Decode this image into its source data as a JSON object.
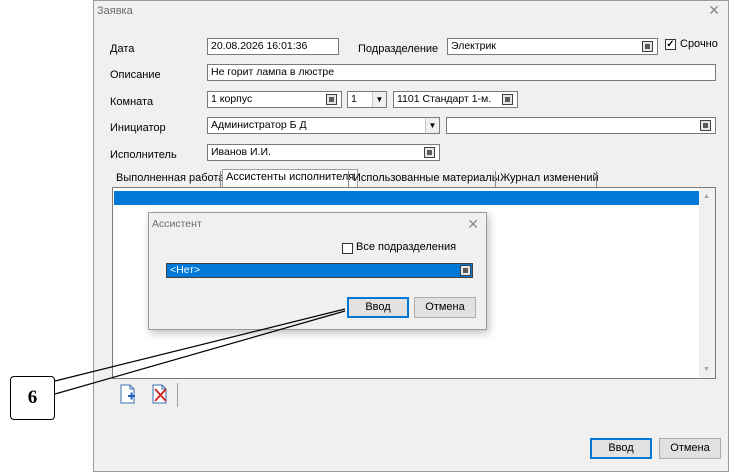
{
  "main_window": {
    "title": "Заявка",
    "close_glyph": "✕"
  },
  "form": {
    "date_label": "Дата",
    "date_value": "20.08.2026 16:01:36",
    "department_label": "Подразделение",
    "department_value": "Электрик",
    "urgent_label": "Срочно",
    "urgent_checked": true,
    "description_label": "Описание",
    "description_value": "Не горит лампа в люстре",
    "room_label": "Комната",
    "room_building": "1 корпус",
    "room_floor": "1",
    "room_number": "1101  Стандарт 1-м.",
    "initiator_label": "Инициатор",
    "initiator_value": "Администратор Б Д",
    "initiator_extra": "",
    "executor_label": "Исполнитель",
    "executor_value": "Иванов И.И."
  },
  "tabs": [
    {
      "label": "Выполненная работа",
      "active": false
    },
    {
      "label": "Ассистенты исполнителя",
      "active": true
    },
    {
      "label": "Использованные материалы",
      "active": false
    },
    {
      "label": "Журнал изменений",
      "active": false
    }
  ],
  "toolbar": {
    "add_icon": "add-document-icon",
    "delete_icon": "delete-document-icon"
  },
  "footer": {
    "ok_label": "Ввод",
    "cancel_label": "Отмена"
  },
  "assist_dialog": {
    "title": "Ассистент",
    "close_glyph": "✕",
    "all_departments_label": "Все подразделения",
    "all_departments_checked": false,
    "assistant_value": "<Нет>",
    "ok_label": "Ввод",
    "cancel_label": "Отмена"
  },
  "callout": {
    "number": "6"
  },
  "colors": {
    "selection": "#0078d7",
    "window_bg": "#f0f0f0"
  }
}
